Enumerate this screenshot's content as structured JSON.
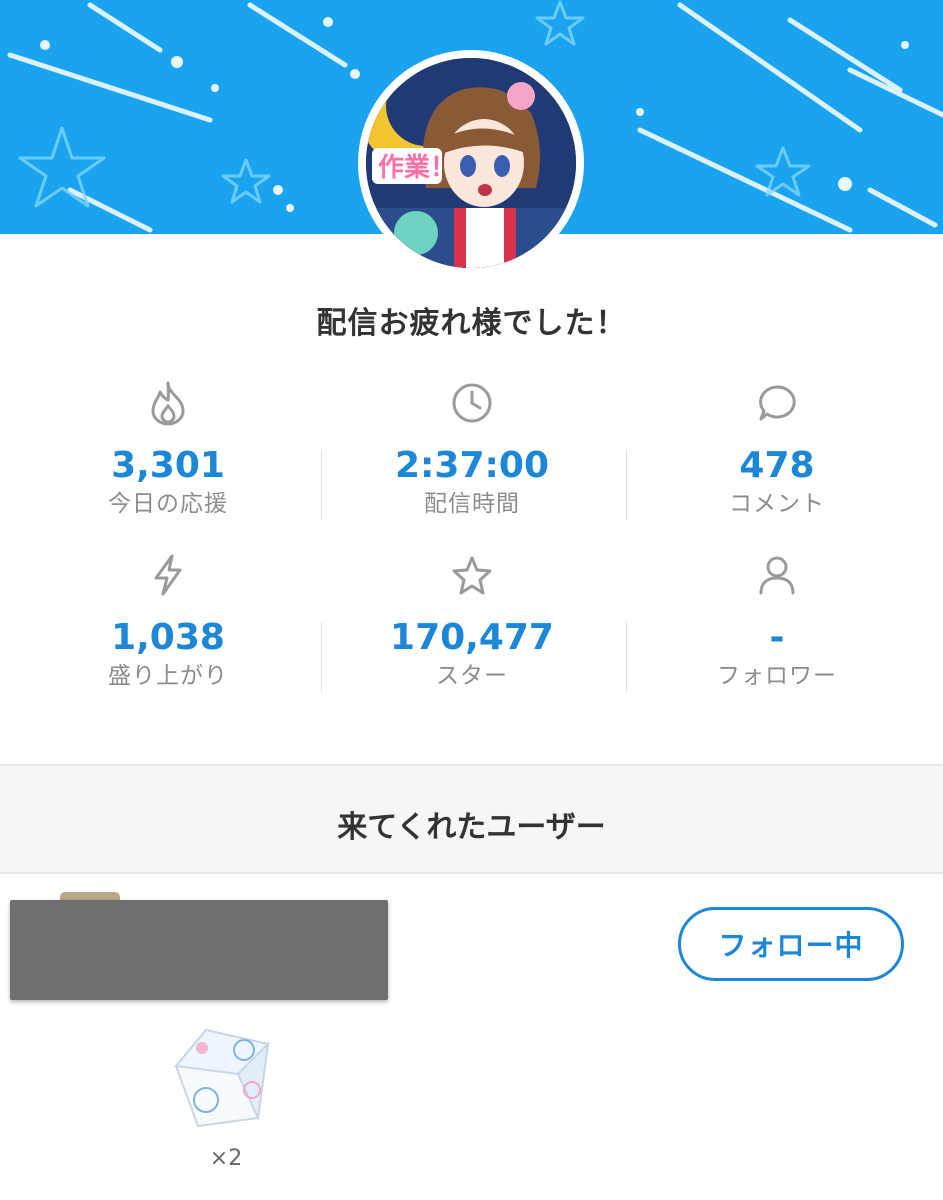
{
  "header": {
    "banner_color": "#1aa4f0",
    "avatar_text": "作業！"
  },
  "title": "配信お疲れ様でした！",
  "stats": [
    {
      "icon": "flame-icon",
      "value": "3,301",
      "label": "今日の応援"
    },
    {
      "icon": "clock-icon",
      "value": "2:37:00",
      "label": "配信時間"
    },
    {
      "icon": "comment-icon",
      "value": "478",
      "label": "コメント"
    },
    {
      "icon": "lightning-icon",
      "value": "1,038",
      "label": "盛り上がり"
    },
    {
      "icon": "star-icon",
      "value": "170,477",
      "label": "スター"
    },
    {
      "icon": "person-icon",
      "value": "-",
      "label": "フォロワー"
    }
  ],
  "visitors": {
    "section_title": "来てくれたユーザー",
    "follow_button": "フォロー中",
    "gift_count": "×2"
  },
  "colors": {
    "accent": "#1b87d6",
    "label_gray": "#8c8c8c"
  }
}
